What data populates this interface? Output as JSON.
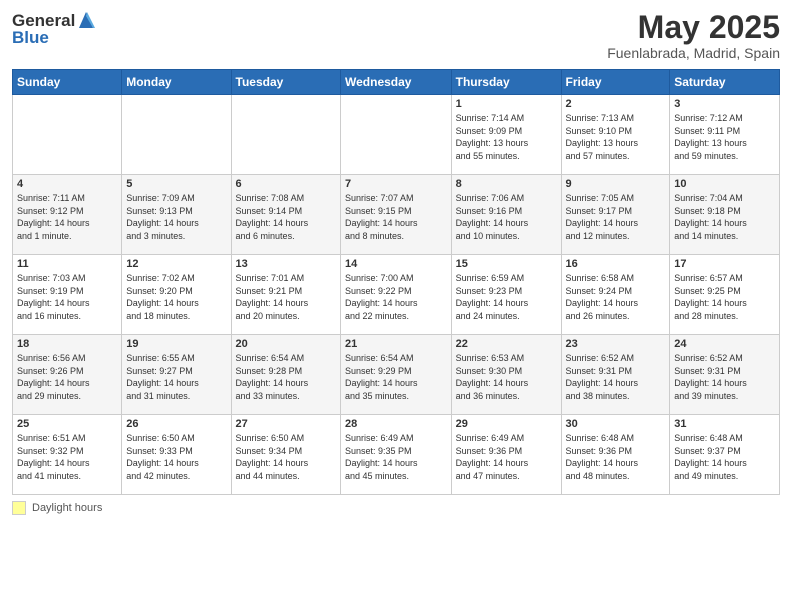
{
  "header": {
    "logo_general": "General",
    "logo_blue": "Blue",
    "month_title": "May 2025",
    "location": "Fuenlabrada, Madrid, Spain"
  },
  "days_of_week": [
    "Sunday",
    "Monday",
    "Tuesday",
    "Wednesday",
    "Thursday",
    "Friday",
    "Saturday"
  ],
  "footer": {
    "daylight_label": "Daylight hours"
  },
  "weeks": [
    {
      "days": [
        {
          "num": "",
          "info": ""
        },
        {
          "num": "",
          "info": ""
        },
        {
          "num": "",
          "info": ""
        },
        {
          "num": "",
          "info": ""
        },
        {
          "num": "1",
          "info": "Sunrise: 7:14 AM\nSunset: 9:09 PM\nDaylight: 13 hours\nand 55 minutes."
        },
        {
          "num": "2",
          "info": "Sunrise: 7:13 AM\nSunset: 9:10 PM\nDaylight: 13 hours\nand 57 minutes."
        },
        {
          "num": "3",
          "info": "Sunrise: 7:12 AM\nSunset: 9:11 PM\nDaylight: 13 hours\nand 59 minutes."
        }
      ]
    },
    {
      "days": [
        {
          "num": "4",
          "info": "Sunrise: 7:11 AM\nSunset: 9:12 PM\nDaylight: 14 hours\nand 1 minute."
        },
        {
          "num": "5",
          "info": "Sunrise: 7:09 AM\nSunset: 9:13 PM\nDaylight: 14 hours\nand 3 minutes."
        },
        {
          "num": "6",
          "info": "Sunrise: 7:08 AM\nSunset: 9:14 PM\nDaylight: 14 hours\nand 6 minutes."
        },
        {
          "num": "7",
          "info": "Sunrise: 7:07 AM\nSunset: 9:15 PM\nDaylight: 14 hours\nand 8 minutes."
        },
        {
          "num": "8",
          "info": "Sunrise: 7:06 AM\nSunset: 9:16 PM\nDaylight: 14 hours\nand 10 minutes."
        },
        {
          "num": "9",
          "info": "Sunrise: 7:05 AM\nSunset: 9:17 PM\nDaylight: 14 hours\nand 12 minutes."
        },
        {
          "num": "10",
          "info": "Sunrise: 7:04 AM\nSunset: 9:18 PM\nDaylight: 14 hours\nand 14 minutes."
        }
      ]
    },
    {
      "days": [
        {
          "num": "11",
          "info": "Sunrise: 7:03 AM\nSunset: 9:19 PM\nDaylight: 14 hours\nand 16 minutes."
        },
        {
          "num": "12",
          "info": "Sunrise: 7:02 AM\nSunset: 9:20 PM\nDaylight: 14 hours\nand 18 minutes."
        },
        {
          "num": "13",
          "info": "Sunrise: 7:01 AM\nSunset: 9:21 PM\nDaylight: 14 hours\nand 20 minutes."
        },
        {
          "num": "14",
          "info": "Sunrise: 7:00 AM\nSunset: 9:22 PM\nDaylight: 14 hours\nand 22 minutes."
        },
        {
          "num": "15",
          "info": "Sunrise: 6:59 AM\nSunset: 9:23 PM\nDaylight: 14 hours\nand 24 minutes."
        },
        {
          "num": "16",
          "info": "Sunrise: 6:58 AM\nSunset: 9:24 PM\nDaylight: 14 hours\nand 26 minutes."
        },
        {
          "num": "17",
          "info": "Sunrise: 6:57 AM\nSunset: 9:25 PM\nDaylight: 14 hours\nand 28 minutes."
        }
      ]
    },
    {
      "days": [
        {
          "num": "18",
          "info": "Sunrise: 6:56 AM\nSunset: 9:26 PM\nDaylight: 14 hours\nand 29 minutes."
        },
        {
          "num": "19",
          "info": "Sunrise: 6:55 AM\nSunset: 9:27 PM\nDaylight: 14 hours\nand 31 minutes."
        },
        {
          "num": "20",
          "info": "Sunrise: 6:54 AM\nSunset: 9:28 PM\nDaylight: 14 hours\nand 33 minutes."
        },
        {
          "num": "21",
          "info": "Sunrise: 6:54 AM\nSunset: 9:29 PM\nDaylight: 14 hours\nand 35 minutes."
        },
        {
          "num": "22",
          "info": "Sunrise: 6:53 AM\nSunset: 9:30 PM\nDaylight: 14 hours\nand 36 minutes."
        },
        {
          "num": "23",
          "info": "Sunrise: 6:52 AM\nSunset: 9:31 PM\nDaylight: 14 hours\nand 38 minutes."
        },
        {
          "num": "24",
          "info": "Sunrise: 6:52 AM\nSunset: 9:31 PM\nDaylight: 14 hours\nand 39 minutes."
        }
      ]
    },
    {
      "days": [
        {
          "num": "25",
          "info": "Sunrise: 6:51 AM\nSunset: 9:32 PM\nDaylight: 14 hours\nand 41 minutes."
        },
        {
          "num": "26",
          "info": "Sunrise: 6:50 AM\nSunset: 9:33 PM\nDaylight: 14 hours\nand 42 minutes."
        },
        {
          "num": "27",
          "info": "Sunrise: 6:50 AM\nSunset: 9:34 PM\nDaylight: 14 hours\nand 44 minutes."
        },
        {
          "num": "28",
          "info": "Sunrise: 6:49 AM\nSunset: 9:35 PM\nDaylight: 14 hours\nand 45 minutes."
        },
        {
          "num": "29",
          "info": "Sunrise: 6:49 AM\nSunset: 9:36 PM\nDaylight: 14 hours\nand 47 minutes."
        },
        {
          "num": "30",
          "info": "Sunrise: 6:48 AM\nSunset: 9:36 PM\nDaylight: 14 hours\nand 48 minutes."
        },
        {
          "num": "31",
          "info": "Sunrise: 6:48 AM\nSunset: 9:37 PM\nDaylight: 14 hours\nand 49 minutes."
        }
      ]
    }
  ]
}
